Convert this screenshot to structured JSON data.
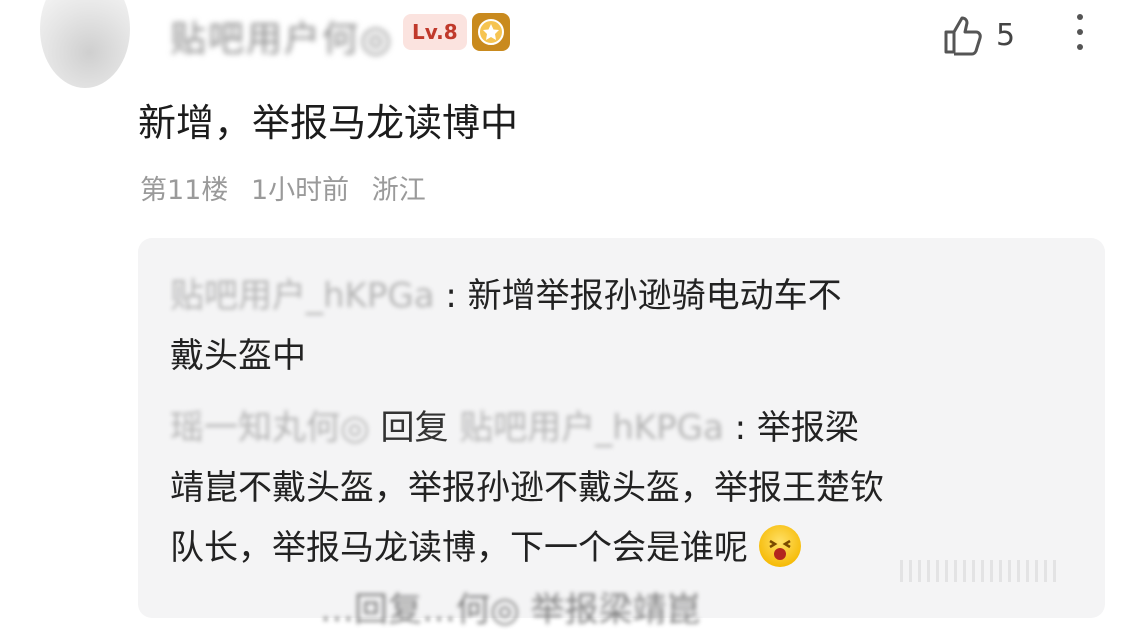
{
  "comment": {
    "username": "贴吧用户何◎",
    "level_badge": "Lv.8",
    "like_count": "5",
    "text": "新增，举报马龙读博中",
    "floor": "第11楼",
    "time": "1小时前",
    "location": "浙江"
  },
  "replies": [
    {
      "author": "贴吧用户_hKPGa",
      "separator": ":",
      "line1": "新增举报孙逊骑电动车不",
      "line2": "戴头盔中"
    },
    {
      "author": "瑶一知丸何◎",
      "verb": "回复",
      "target": "贴吧用户_hKPGa",
      "separator": ":",
      "line1": "举报梁",
      "line2": "靖崑不戴头盔，举报孙逊不戴头盔，举报王楚钦",
      "line3": "队长，举报马龙读博，下一个会是谁呢"
    }
  ],
  "partial_bottom": "…回复…何◎ 举报梁靖崑"
}
